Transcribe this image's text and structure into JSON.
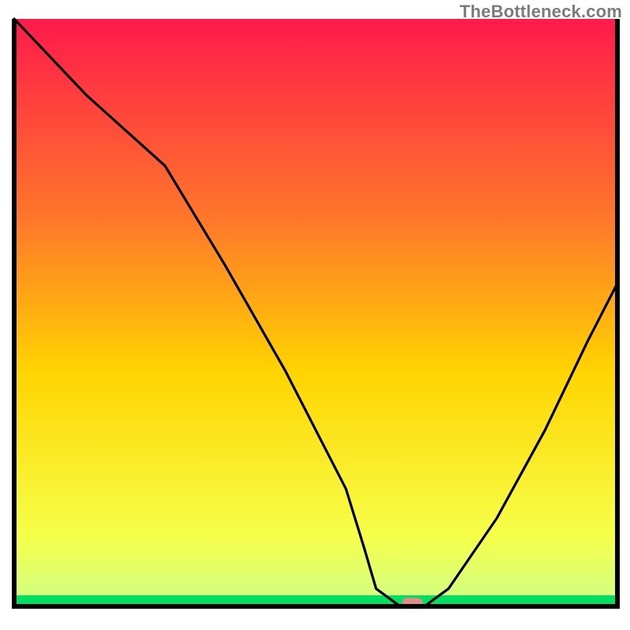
{
  "attribution": "TheBottleneck.com",
  "chart_data": {
    "type": "line",
    "title": "",
    "xlabel": "",
    "ylabel": "",
    "xlim": [
      0,
      100
    ],
    "ylim": [
      0,
      100
    ],
    "grid": false,
    "legend": false,
    "background_gradient": {
      "top_color": "#ff1a4b",
      "upper_mid_color": "#ff7a2a",
      "mid_color": "#ffd400",
      "lower_mid_color": "#f6ff4a",
      "bottom_band_color": "#00e060"
    },
    "series": [
      {
        "name": "bottleneck-curve",
        "x": [
          0,
          12,
          25,
          35,
          45,
          55,
          58,
          60,
          64,
          68,
          72,
          80,
          88,
          95,
          100
        ],
        "y": [
          100,
          87,
          75,
          58,
          40,
          20,
          10,
          3,
          0,
          0,
          3,
          15,
          30,
          45,
          55
        ]
      }
    ],
    "marker": {
      "name": "optimal-point",
      "x": 66,
      "y": 0.5,
      "color": "#e58a8a",
      "shape": "rounded-rect"
    },
    "axes": {
      "stroke": "#000000",
      "show_ticks": false
    }
  }
}
